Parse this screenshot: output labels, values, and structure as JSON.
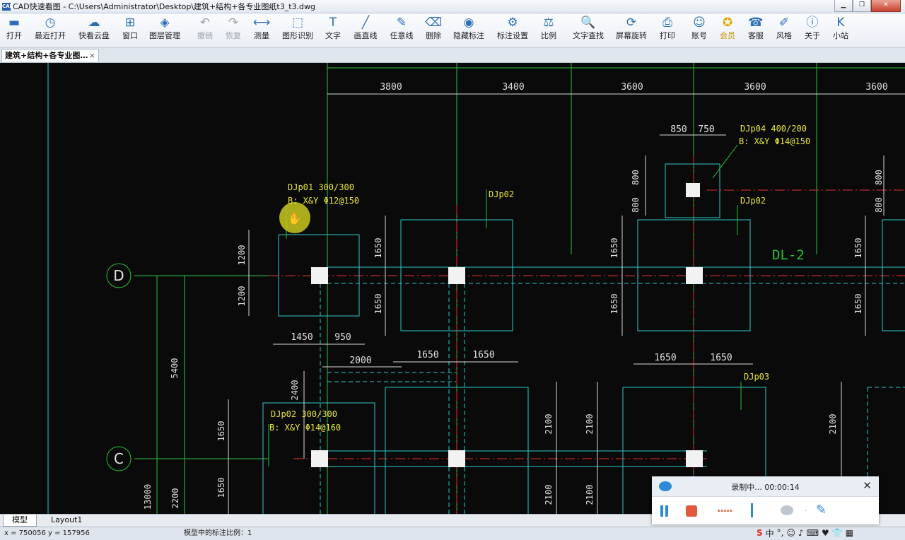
{
  "window": {
    "app_icon": "CAD",
    "title": "CAD快速看图 - C:\\Users\\Administrator\\Desktop\\建筑+结构+各专业图纸t3_t3.dwg",
    "buttons": [
      "minimize",
      "restore",
      "close"
    ]
  },
  "toolbar": [
    {
      "label": "打开",
      "icon": "folder-open-icon",
      "enabled": true
    },
    {
      "label": "最近打开",
      "icon": "clock-icon",
      "enabled": true
    },
    {
      "label": "快看云盘",
      "icon": "cloud-icon",
      "enabled": true
    },
    {
      "label": "窗口",
      "icon": "window-icon",
      "enabled": true
    },
    {
      "label": "图层管理",
      "icon": "layers-icon",
      "enabled": true
    },
    {
      "label": "撤销",
      "icon": "undo-icon",
      "enabled": false
    },
    {
      "label": "恢复",
      "icon": "redo-icon",
      "enabled": false
    },
    {
      "label": "测量",
      "icon": "ruler-icon",
      "enabled": true
    },
    {
      "label": "图形识别",
      "icon": "shape-recognize-icon",
      "enabled": true
    },
    {
      "label": "文字",
      "icon": "text-icon",
      "enabled": true
    },
    {
      "label": "画直线",
      "icon": "line-icon",
      "enabled": true
    },
    {
      "label": "任意线",
      "icon": "freehand-icon",
      "enabled": true
    },
    {
      "label": "删除",
      "icon": "eraser-icon",
      "enabled": true
    },
    {
      "label": "隐藏标注",
      "icon": "eye-icon",
      "enabled": true
    },
    {
      "label": "标注设置",
      "icon": "settings-icon",
      "enabled": true
    },
    {
      "label": "比例",
      "icon": "scale-icon",
      "enabled": true
    },
    {
      "label": "文字查找",
      "icon": "text-search-icon",
      "enabled": true
    },
    {
      "label": "屏幕旋转",
      "icon": "rotate-icon",
      "enabled": true
    },
    {
      "label": "打印",
      "icon": "printer-icon",
      "enabled": true
    },
    {
      "label": "账号",
      "icon": "user-icon",
      "enabled": true
    },
    {
      "label": "会员",
      "icon": "vip-icon",
      "enabled": true
    },
    {
      "label": "客服",
      "icon": "headset-icon",
      "enabled": true
    },
    {
      "label": "风格",
      "icon": "style-icon",
      "enabled": true
    },
    {
      "label": "关于",
      "icon": "info-icon",
      "enabled": true
    },
    {
      "label": "小站",
      "icon": "site-icon",
      "enabled": true
    }
  ],
  "document_tab": {
    "label": "建筑+结构+各专业图…",
    "close": "×"
  },
  "drawing": {
    "top_dims": [
      "3800",
      "3400",
      "3600",
      "3600",
      "3600"
    ],
    "grid_bubbles": [
      "D",
      "C"
    ],
    "labels": {
      "djp01_a": "DJp01 300/300",
      "djp01_b": "B: X&Y Φ12@150",
      "djp02_top": "DJp02",
      "djp04_a": "DJp04 400/200",
      "djp04_b": "B: X&Y Φ14@150",
      "djp02_right": "DJp02",
      "dl2": "DL-2",
      "djp02_lower_a": "DJp02 300/300",
      "djp02_lower_b": "B: X&Y Φ14@160",
      "djp03": "DJp03"
    },
    "dims": {
      "d850": "850",
      "d750": "750",
      "d800a": "800",
      "d800b": "800",
      "d800c": "800",
      "d800d": "800",
      "d1200a": "1200",
      "d1200b": "1200",
      "d1650": "1650",
      "d1450": "1450",
      "d950": "950",
      "d2000": "2000",
      "d2400": "2400",
      "d5400": "5400",
      "d2100": "2100",
      "d2200": "2200",
      "d13000": "13000"
    }
  },
  "sheet_tabs": [
    "模型",
    "Layout1"
  ],
  "status": {
    "coords": "x = 750056  y = 157956",
    "scale_text": "模型中的标注比例：1"
  },
  "recorder": {
    "status": "录制中... 00:00:14",
    "close": "✕",
    "dots": "....."
  },
  "tray": [
    "中",
    "°,",
    "☺",
    "♪",
    "⌨",
    "♥",
    "👕",
    "▦"
  ]
}
